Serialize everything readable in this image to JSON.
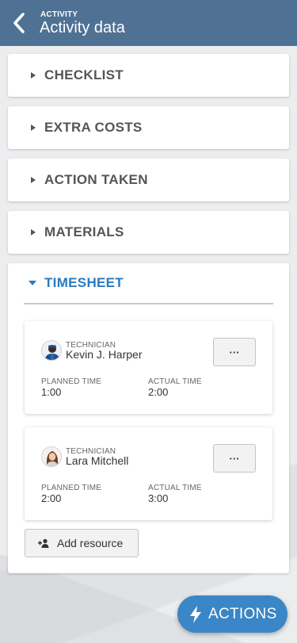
{
  "header": {
    "eyebrow": "ACTIVITY",
    "title": "Activity data",
    "back_icon": "chevron-left-icon",
    "color": "#4f7194"
  },
  "sections": {
    "checklist": "CHECKLIST",
    "extra_costs": "EXTRA COSTS",
    "action_taken": "ACTION TAKEN",
    "materials": "MATERIALS",
    "timesheet": "TIMESHEET"
  },
  "timesheet": {
    "expanded": true,
    "accent": "#2a7bc0",
    "resources": [
      {
        "role": "TECHNICIAN",
        "name": "Kevin J. Harper",
        "more_label": "···",
        "planned_label": "PLANNED TIME",
        "planned_value": "1:00",
        "actual_label": "ACTUAL TIME",
        "actual_value": "2:00"
      },
      {
        "role": "TECHNICIAN",
        "name": "Lara Mitchell",
        "more_label": "···",
        "planned_label": "PLANNED TIME",
        "planned_value": "2:00",
        "actual_label": "ACTUAL TIME",
        "actual_value": "3:00"
      }
    ],
    "add_resource_label": "Add resource"
  },
  "fab": {
    "label": "ACTIONS",
    "icon": "lightning-icon",
    "color": "#3a86c6"
  }
}
